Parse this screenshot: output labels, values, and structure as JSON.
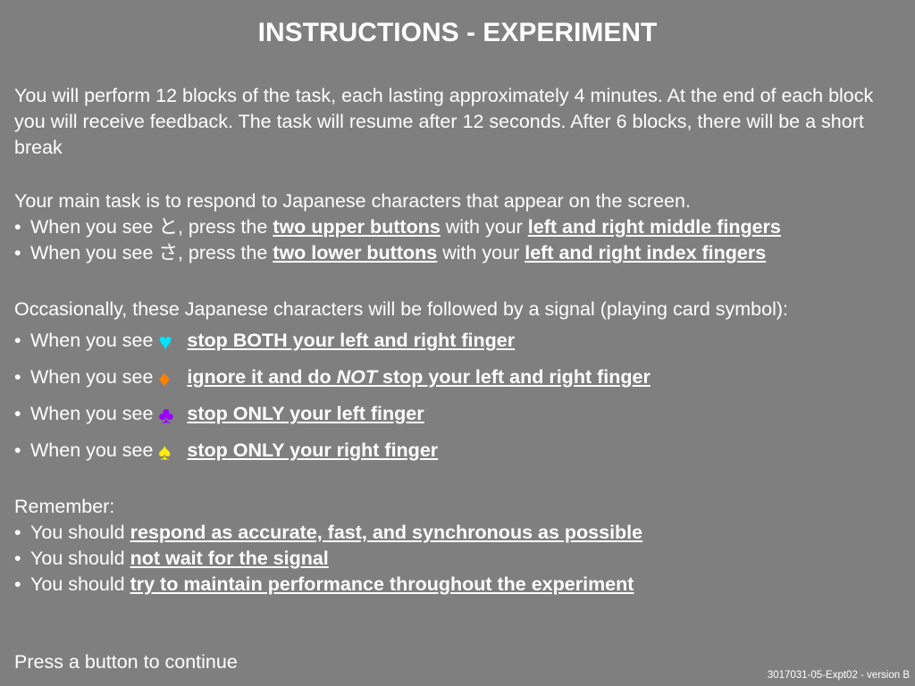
{
  "title": "INSTRUCTIONS - EXPERIMENT",
  "intro": "You will perform 12 blocks of the task, each lasting approximately 4 minutes. At the end of each block you will receive feedback. The task will resume after 12 seconds. After 6 blocks, there will be a short break",
  "task": {
    "heading": "Your main task is to respond to Japanese characters that appear on the screen.",
    "items": [
      {
        "pre": "When you see ",
        "char": "と",
        "mid": ", press the ",
        "b1": "two upper buttons",
        "mid2": " with your ",
        "b2": "left and right middle fingers"
      },
      {
        "pre": "When you see ",
        "char": "さ",
        "mid": ", press the ",
        "b1": "two lower buttons",
        "mid2": " with your ",
        "b2": "left and right index fingers"
      }
    ]
  },
  "signals": {
    "heading": "Occasionally, these Japanese characters will be followed by a signal (playing card symbol):",
    "prefix": "When you see ",
    "items": [
      {
        "symbol": "♥",
        "color": "#00e5ff",
        "text": "stop BOTH your left and right finger"
      },
      {
        "symbol": "♦",
        "color": "#ff7f00",
        "text_a": "ignore it and do ",
        "text_not": "NOT",
        "text_b": " stop your left and right finger"
      },
      {
        "symbol": "♣",
        "color": "#9b00ff",
        "text": "stop ONLY your left finger"
      },
      {
        "symbol": "♠",
        "color": "#ffee00",
        "text": "stop ONLY your right finger"
      }
    ]
  },
  "remember": {
    "heading": "Remember:",
    "prefix": "You should ",
    "items": [
      "respond as accurate, fast, and synchronous as possible",
      "not wait for the signal",
      "try to maintain performance throughout the experiment"
    ]
  },
  "press": "Press a button to continue",
  "version": "3017031-05-Expt02 - version B",
  "bullet": "•"
}
